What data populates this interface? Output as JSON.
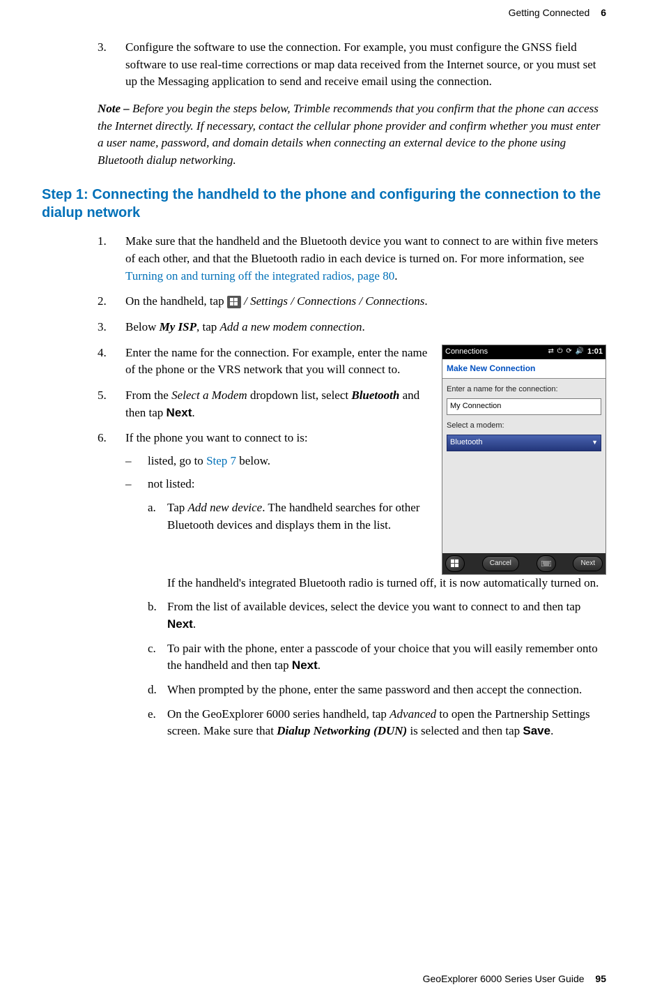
{
  "header": {
    "chapter_title": "Getting Connected",
    "chapter_number": "6"
  },
  "top_step": {
    "num": "3.",
    "text": "Configure the software to use the connection. For example, you must configure the GNSS field software to use real-time corrections or map data received from the Internet source, or you must set up the Messaging application to send and receive email using the connection."
  },
  "note": {
    "label": "Note – ",
    "text": "Before you begin the steps below, Trimble recommends that you confirm that the phone can access the Internet directly. If necessary, contact the cellular phone provider and confirm whether you must enter a user name, password, and domain details when connecting an external device to the phone using Bluetooth dialup networking."
  },
  "step_heading": "Step 1: Connecting the handheld to the phone and configuring the connection to the dialup network",
  "steps": {
    "s1": {
      "num": "1.",
      "pre": "Make sure that the handheld and the Bluetooth device you want to connect to are within five meters of each other, and that the Bluetooth radio in each device is turned on. For more information, see ",
      "link": "Turning on and turning off the integrated radios, page 80",
      "post": "."
    },
    "s2": {
      "num": "2.",
      "pre": "On the handheld, tap ",
      "path": " / Settings / Connections / Connections",
      "post": "."
    },
    "s3": {
      "num": "3.",
      "pre": "Below ",
      "bold1": "My ISP",
      "mid": ", tap ",
      "ital1": "Add a new modem connection",
      "post": "."
    },
    "s4": {
      "num": "4.",
      "text": "Enter the name for the connection. For example, enter the name of the phone or the VRS network that you will connect to."
    },
    "s5": {
      "num": "5.",
      "pre": "From the ",
      "ital1": "Select a Modem",
      "mid1": " dropdown list, select ",
      "bold1": "Bluetooth",
      "mid2": " and then tap ",
      "sans1": "Next",
      "post": "."
    },
    "s6": {
      "num": "6.",
      "text": "If the phone you want to connect to is:",
      "sub1": {
        "dash": "–",
        "pre": "listed, go to ",
        "link": "Step 7",
        "post": " below."
      },
      "sub2": {
        "dash": "–",
        "text": "not listed:"
      },
      "a": {
        "letter": "a.",
        "p1_pre": "Tap ",
        "p1_it": "Add new device",
        "p1_post": ". The handheld searches for other Bluetooth devices and displays them in the list.",
        "p2": "If the handheld's integrated Bluetooth radio is turned off, it is now automatically turned on."
      },
      "b": {
        "letter": "b.",
        "pre": "From the list of available devices, select the device you want to connect to and then tap ",
        "sans": "Next",
        "post": "."
      },
      "c": {
        "letter": "c.",
        "pre": "To pair with the phone, enter a passcode of your choice that you will easily remember onto the handheld and then tap ",
        "sans": "Next",
        "post": "."
      },
      "d": {
        "letter": "d.",
        "text": "When prompted by the phone, enter the same password and then accept the connection."
      },
      "e": {
        "letter": "e.",
        "pre": "On the GeoExplorer 6000 series handheld, tap ",
        "it1": "Advanced",
        "mid1": " to open the Partnership Settings screen. Make sure that ",
        "bdit1": "Dialup Networking (DUN)",
        "mid2": " is selected and then tap ",
        "sans": "Save",
        "post": "."
      }
    }
  },
  "screenshot": {
    "title": "Connections",
    "tray_icons": "⇄ ⏻ ⟳ 🔊",
    "clock": "1:01",
    "header": "Make New Connection",
    "label1": "Enter a name for the connection:",
    "input_value": "My Connection",
    "label2": "Select a modem:",
    "dropdown_value": "Bluetooth",
    "btn_cancel": "Cancel",
    "btn_next": "Next"
  },
  "footer": {
    "title": "GeoExplorer 6000 Series User Guide",
    "page": "95"
  }
}
